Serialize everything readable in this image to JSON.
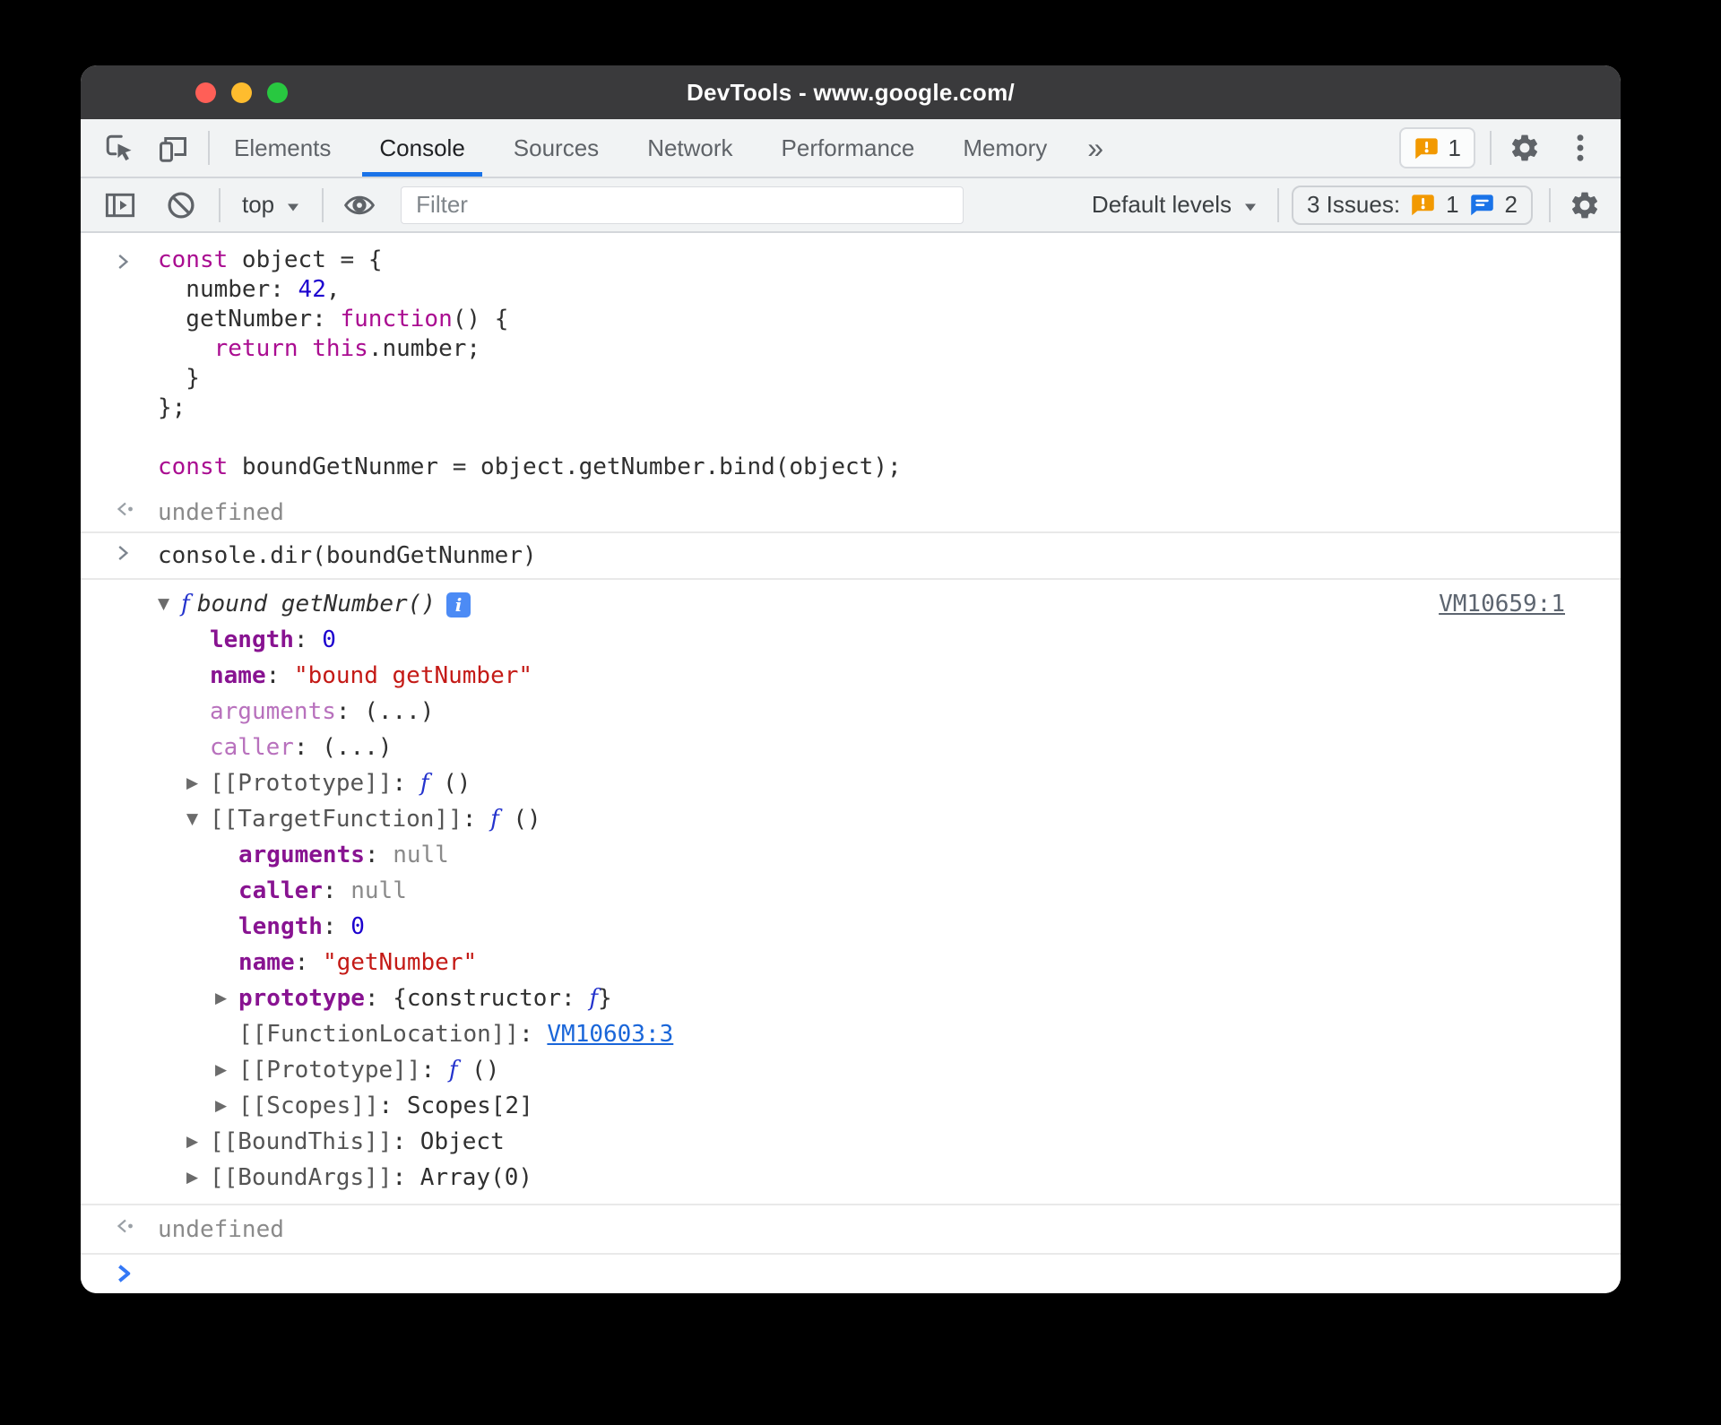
{
  "window": {
    "title": "DevTools - www.google.com/"
  },
  "tabs": {
    "items": [
      "Elements",
      "Console",
      "Sources",
      "Network",
      "Performance",
      "Memory"
    ],
    "selected": "Console",
    "more_label": "»",
    "error_badge_count": "1"
  },
  "toolbar": {
    "context_label": "top",
    "filter_placeholder": "Filter",
    "levels_label": "Default levels",
    "issues_label": "3 Issues:",
    "issues_error_count": "1",
    "issues_message_count": "2"
  },
  "console": {
    "command1_lines": [
      [
        {
          "c": "kw",
          "t": "const"
        },
        {
          "c": "plain",
          "t": " object = {"
        }
      ],
      [
        {
          "c": "plain",
          "t": "  number: "
        },
        {
          "c": "num",
          "t": "42"
        },
        {
          "c": "plain",
          "t": ","
        }
      ],
      [
        {
          "c": "plain",
          "t": "  getNumber: "
        },
        {
          "c": "kw",
          "t": "function"
        },
        {
          "c": "plain",
          "t": "() {"
        }
      ],
      [
        {
          "c": "plain",
          "t": "    "
        },
        {
          "c": "kw",
          "t": "return"
        },
        {
          "c": "plain",
          "t": " "
        },
        {
          "c": "kw",
          "t": "this"
        },
        {
          "c": "plain",
          "t": ".number;"
        }
      ],
      [
        {
          "c": "plain",
          "t": "  }"
        }
      ],
      [
        {
          "c": "plain",
          "t": "};"
        }
      ],
      [],
      [
        {
          "c": "kw",
          "t": "const"
        },
        {
          "c": "plain",
          "t": " boundGetNunmer = object.getNumber.bind(object);"
        }
      ]
    ],
    "result1": "undefined",
    "command2_lines": [
      [
        {
          "c": "plain",
          "t": "console.dir(boundGetNunmer)"
        }
      ]
    ],
    "dir_tree": [
      {
        "level": 0,
        "expander": "▼",
        "tokens": [
          {
            "c": "f",
            "t": "f "
          },
          {
            "c": "fn",
            "t": "bound getNumber()"
          },
          {
            "c": "badge",
            "t": "i"
          }
        ],
        "location": "VM10659:1"
      },
      {
        "level": 1,
        "tokens": [
          {
            "c": "prop",
            "t": "length"
          },
          {
            "c": "plain",
            "t": ": "
          },
          {
            "c": "num",
            "t": "0"
          }
        ]
      },
      {
        "level": 1,
        "tokens": [
          {
            "c": "prop",
            "t": "name"
          },
          {
            "c": "plain",
            "t": ": "
          },
          {
            "c": "str",
            "t": "\"bound getNumber\""
          }
        ]
      },
      {
        "level": 1,
        "tokens": [
          {
            "c": "propdim",
            "t": "arguments"
          },
          {
            "c": "plain",
            "t": ": (...)"
          }
        ]
      },
      {
        "level": 1,
        "tokens": [
          {
            "c": "propdim",
            "t": "caller"
          },
          {
            "c": "plain",
            "t": ": (...)"
          }
        ]
      },
      {
        "level": 1,
        "expander": "▶",
        "tokens": [
          {
            "c": "int",
            "t": "[[Prototype]]"
          },
          {
            "c": "plain",
            "t": ": "
          },
          {
            "c": "f",
            "t": "f"
          },
          {
            "c": "plain",
            "t": " ()"
          }
        ]
      },
      {
        "level": 1,
        "expander": "▼",
        "tokens": [
          {
            "c": "int",
            "t": "[[TargetFunction]]"
          },
          {
            "c": "plain",
            "t": ": "
          },
          {
            "c": "f",
            "t": "f"
          },
          {
            "c": "plain",
            "t": " ()"
          }
        ]
      },
      {
        "level": 2,
        "tokens": [
          {
            "c": "prop",
            "t": "arguments"
          },
          {
            "c": "plain",
            "t": ": "
          },
          {
            "c": "gray",
            "t": "null"
          }
        ]
      },
      {
        "level": 2,
        "tokens": [
          {
            "c": "prop",
            "t": "caller"
          },
          {
            "c": "plain",
            "t": ": "
          },
          {
            "c": "gray",
            "t": "null"
          }
        ]
      },
      {
        "level": 2,
        "tokens": [
          {
            "c": "prop",
            "t": "length"
          },
          {
            "c": "plain",
            "t": ": "
          },
          {
            "c": "num",
            "t": "0"
          }
        ]
      },
      {
        "level": 2,
        "tokens": [
          {
            "c": "prop",
            "t": "name"
          },
          {
            "c": "plain",
            "t": ": "
          },
          {
            "c": "str",
            "t": "\"getNumber\""
          }
        ]
      },
      {
        "level": 2,
        "expander": "▶",
        "tokens": [
          {
            "c": "prop",
            "t": "prototype"
          },
          {
            "c": "plain",
            "t": ": {constructor: "
          },
          {
            "c": "f",
            "t": "f"
          },
          {
            "c": "plain",
            "t": "}"
          }
        ]
      },
      {
        "level": 2,
        "tokens": [
          {
            "c": "int",
            "t": "[[FunctionLocation]]"
          },
          {
            "c": "plain",
            "t": ": "
          },
          {
            "c": "link",
            "t": "VM10603:3"
          }
        ]
      },
      {
        "level": 2,
        "expander": "▶",
        "tokens": [
          {
            "c": "int",
            "t": "[[Prototype]]"
          },
          {
            "c": "plain",
            "t": ": "
          },
          {
            "c": "f",
            "t": "f"
          },
          {
            "c": "plain",
            "t": " ()"
          }
        ]
      },
      {
        "level": 2,
        "expander": "▶",
        "tokens": [
          {
            "c": "int",
            "t": "[[Scopes]]"
          },
          {
            "c": "plain",
            "t": ": Scopes[2]"
          }
        ]
      },
      {
        "level": 1,
        "expander": "▶",
        "tokens": [
          {
            "c": "int",
            "t": "[[BoundThis]]"
          },
          {
            "c": "plain",
            "t": ": Object"
          }
        ]
      },
      {
        "level": 1,
        "expander": "▶",
        "tokens": [
          {
            "c": "int",
            "t": "[[BoundArgs]]"
          },
          {
            "c": "plain",
            "t": ": Array(0)"
          }
        ]
      }
    ],
    "result2": "undefined"
  },
  "colors": {
    "accent_blue": "#1a73e8",
    "titlebar_bg": "#3a3a3c",
    "chrome_bg": "#f1f3f4",
    "chrome_border": "#d3d6da",
    "icon_gray": "#5f6368",
    "tab_text": "#5f6368",
    "tab_selected_text": "#202124",
    "issue_orange": "#f29900",
    "issue_blue": "#1a73e8",
    "traffic_red": "#ff5f57",
    "traffic_yellow": "#febc2e",
    "traffic_green": "#28c840",
    "kw": "#aa0d91",
    "num": "#1c00cf",
    "str": "#c41a16",
    "prop": "#881391",
    "prop_dim": "#b871bd",
    "internal": "#545454",
    "func": "#2433cd",
    "link_blue": "#1a66d9",
    "link_gray": "#5d6570",
    "muted": "#8a8a8a",
    "row_border": "#e9e9e9",
    "prompt_blue": "#3478f6",
    "badge_blue": "#4c8bf5"
  }
}
